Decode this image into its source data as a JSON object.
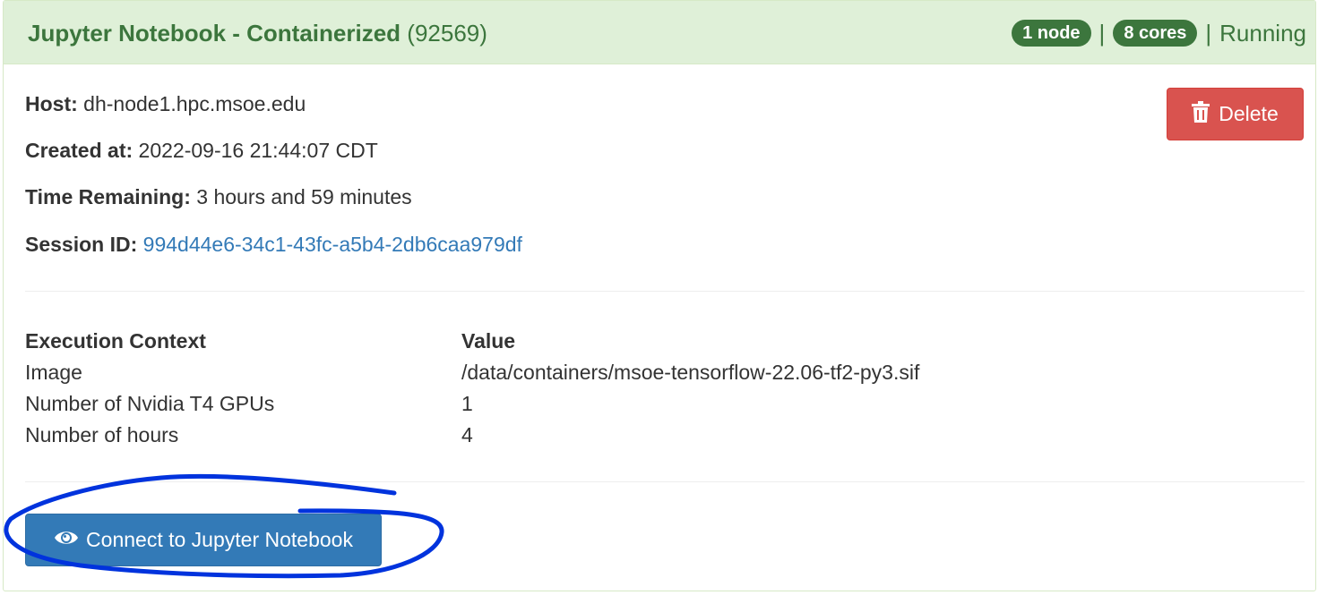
{
  "header": {
    "app_name": "Jupyter Notebook - Containerized",
    "job_id": "(92569)",
    "nodes_badge": "1 node",
    "cores_badge": "8 cores",
    "separator": "|",
    "status": "Running",
    "colors": {
      "header_bg": "#dff0d8",
      "header_text": "#3c763d",
      "badge_bg": "#3c763d"
    }
  },
  "details": {
    "host_label": "Host:",
    "host_value": "dh-node1.hpc.msoe.edu",
    "created_label": "Created at:",
    "created_value": "2022-09-16 21:44:07 CDT",
    "remaining_label": "Time Remaining:",
    "remaining_value": "3 hours and 59 minutes",
    "session_label": "Session ID:",
    "session_value": "994d44e6-34c1-43fc-a5b4-2db6caa979df"
  },
  "actions": {
    "delete_label": "Delete",
    "delete_icon": "trash-icon",
    "delete_color": "#d9534f",
    "connect_label": "Connect to Jupyter Notebook",
    "connect_icon": "eye-icon",
    "connect_color": "#337ab7"
  },
  "context_table": {
    "headers": [
      "Execution Context",
      "Value"
    ],
    "rows": [
      [
        "Image",
        "/data/containers/msoe-tensorflow-22.06-tf2-py3.sif"
      ],
      [
        "Number of Nvidia T4 GPUs",
        "1"
      ],
      [
        "Number of hours",
        "4"
      ]
    ]
  },
  "annotation": {
    "color": "#0033dd"
  }
}
